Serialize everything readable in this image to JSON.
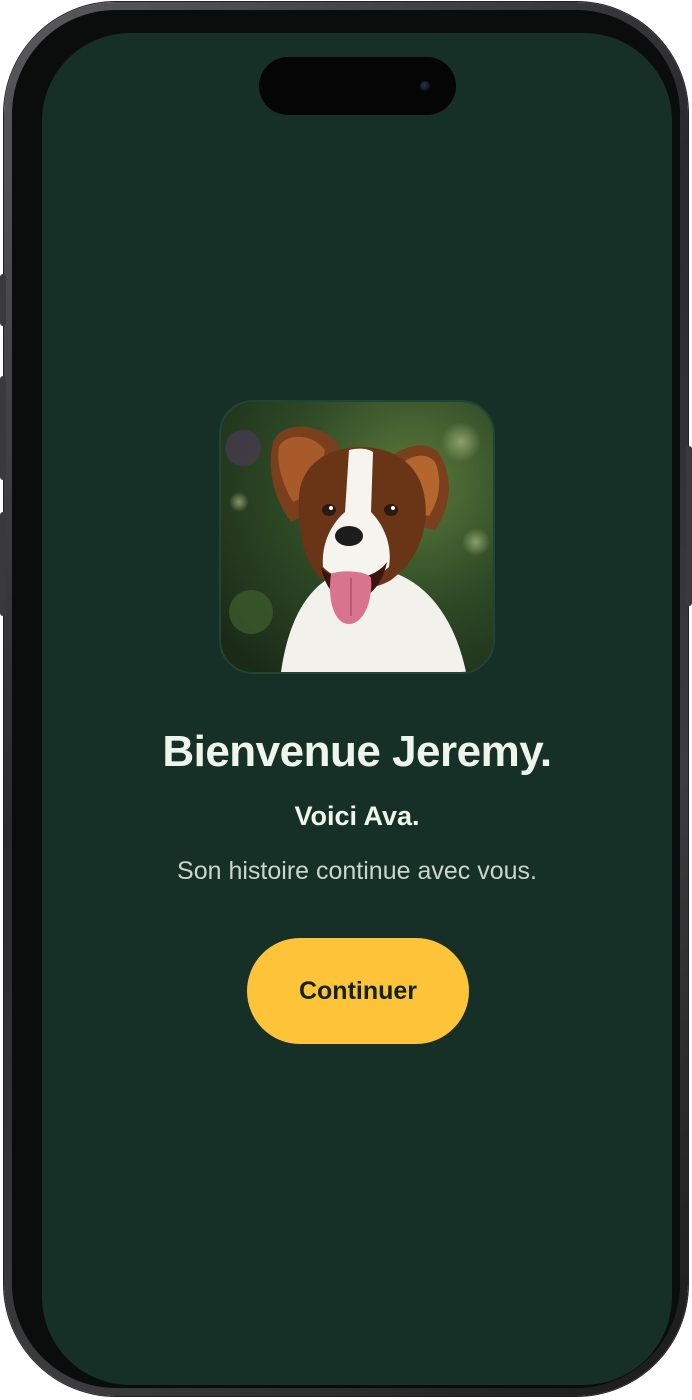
{
  "onboarding": {
    "title": "Bienvenue Jeremy.",
    "subtitle": "Voici Ava.",
    "tagline": "Son histoire continue avec vous.",
    "continue_label": "Continuer",
    "pet_photo_alt": "Ava"
  },
  "colors": {
    "background": "#173027",
    "text_primary": "#eef5ee",
    "text_secondary": "#c9d6cd",
    "accent": "#fdc43a",
    "button_text": "#14231c"
  },
  "icons": {
    "pet_photo": "dog-portrait-image"
  }
}
